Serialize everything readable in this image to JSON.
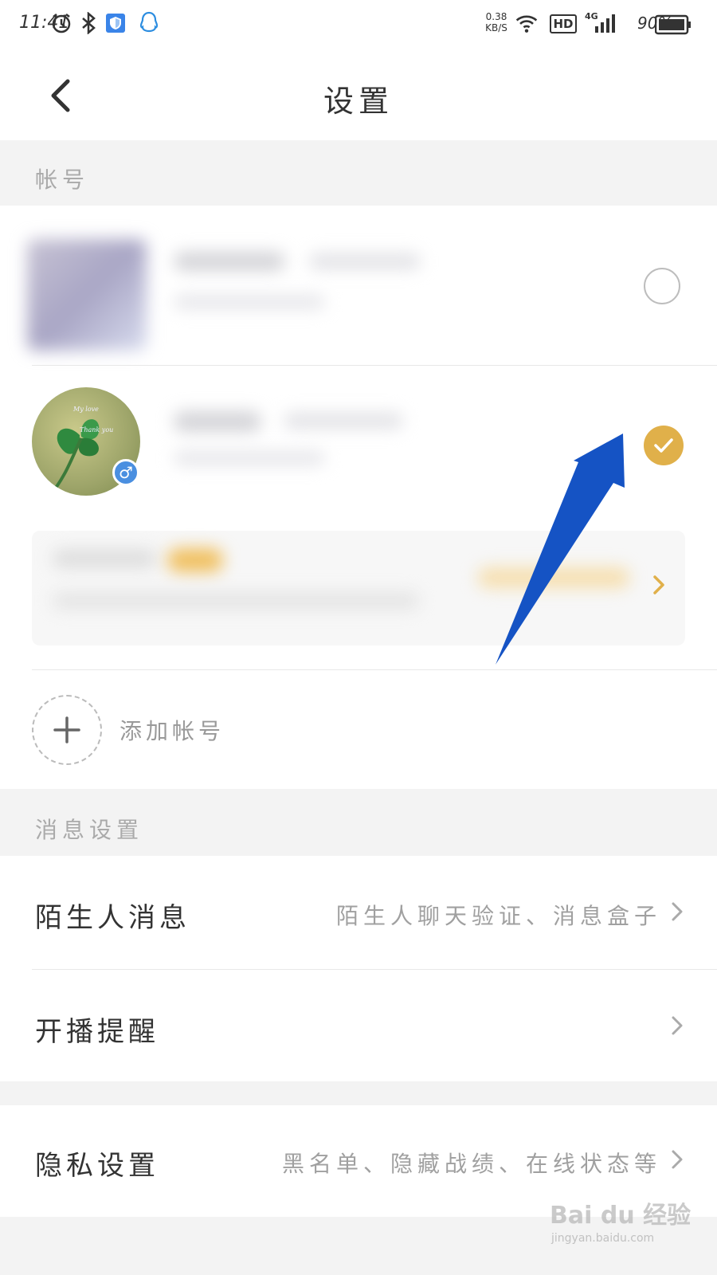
{
  "status_bar": {
    "time": "11:41",
    "net_speed_value": "0.38",
    "net_speed_unit": "KB/S",
    "hd_label": "HD",
    "signal_label": "4G",
    "battery_percent": "90%"
  },
  "nav": {
    "title": "设置",
    "back_icon": "chevron-left-icon"
  },
  "accounts": {
    "section_label": "帐号",
    "add_label": "添加帐号",
    "rows": [
      {
        "selected": false
      },
      {
        "selected": true
      }
    ]
  },
  "messages": {
    "section_label": "消息设置",
    "stranger_title": "陌生人消息",
    "stranger_sub": "陌生人聊天验证、消息盒子",
    "live_title": "开播提醒"
  },
  "privacy": {
    "title": "隐私设置",
    "sub": "黑名单、隐藏战绩、在线状态等"
  },
  "watermark": {
    "main": "Bai du 经验",
    "sub": "jingyan.baidu.com"
  },
  "colors": {
    "accent": "#e0b04a",
    "arrow": "#1553c4",
    "section_bg": "#f3f3f3"
  }
}
